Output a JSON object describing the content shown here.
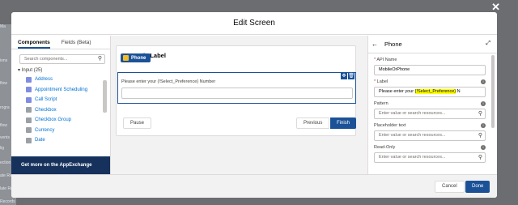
{
  "background": {
    "items": [
      "Ma",
      "ions",
      "flow",
      "rogra",
      "flow",
      "vents",
      "lig",
      "ection",
      "ate Re",
      "late Re",
      "Records"
    ]
  },
  "modal": {
    "title": "Edit Screen",
    "close_icon": "close-icon"
  },
  "left_panel": {
    "tabs": [
      {
        "label": "Components"
      },
      {
        "label": "Fields (Beta)"
      }
    ],
    "search_placeholder": "Search components...",
    "section_label": "Input (25)",
    "items": [
      {
        "label": "Address",
        "icon": "address-icon"
      },
      {
        "label": "Appointment Scheduling",
        "icon": "calendar-icon"
      },
      {
        "label": "Call Script",
        "icon": "script-icon"
      },
      {
        "label": "Checkbox",
        "icon": "checkbox-icon"
      },
      {
        "label": "Checkbox Group",
        "icon": "checkbox-group-icon"
      },
      {
        "label": "Currency",
        "icon": "currency-icon"
      },
      {
        "label": "Date",
        "icon": "date-icon"
      }
    ],
    "appexchange_label": "Get more on the AppExchange"
  },
  "canvas": {
    "title": "Dynamic Label",
    "component_badge": "Phone",
    "field_label": "Please enter your {!Select_Preference} Number",
    "buttons": {
      "pause": "Pause",
      "previous": "Previous",
      "finish": "Finish"
    }
  },
  "right_panel": {
    "title": "Phone",
    "api_name_label": "API Name",
    "api_name_value": "MobileOrPhone",
    "label_label": "Label",
    "label_prefix": "Please enter your ",
    "label_highlight": "{!Select_Preference}",
    "label_suffix": " N",
    "pattern_label": "Pattern",
    "pattern_placeholder": "Enter value or search resources...",
    "placeholder_label": "Placeholder text",
    "placeholder_placeholder": "Enter value or search resources...",
    "readonly_label": "Read-Only",
    "readonly_placeholder": "Enter value or search resources..."
  },
  "footer": {
    "cancel": "Cancel",
    "done": "Done"
  }
}
